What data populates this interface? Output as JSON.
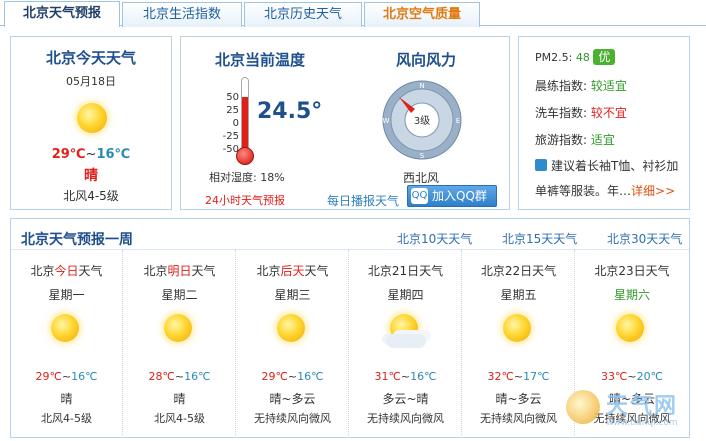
{
  "tabs": [
    {
      "label": "北京天气预报"
    },
    {
      "label": "北京生活指数"
    },
    {
      "label": "北京历史天气"
    },
    {
      "label": "北京空气质量"
    }
  ],
  "today": {
    "title": "北京今天天气",
    "date": "05月18日",
    "temp_high": "29℃",
    "temp_sep": "~",
    "temp_low": "16℃",
    "condition": "晴",
    "wind": "北风4-5级"
  },
  "current": {
    "title": "北京当前温度",
    "temperature": "24.5°",
    "temperature_value": 24.5,
    "ticks": [
      "50",
      "25",
      "0",
      "-25",
      "-50"
    ],
    "humidity": "相对湿度: 18%",
    "forecast_link": "24小时天气预报"
  },
  "wind_panel": {
    "title": "风向风力",
    "level": "3级",
    "direction": "西北风",
    "compass": {
      "n": "N",
      "s": "S",
      "e": "E",
      "w": "W"
    },
    "daily_broadcast": "每日播报天气",
    "qq_button": "加入QQ群",
    "qq_icon": "QQ"
  },
  "indices": {
    "pm_label": "PM2.5: ",
    "pm_value": "48",
    "pm_badge": "优",
    "items": [
      {
        "label": "晨练指数: ",
        "value": "较适宜",
        "color": "#2e9a26"
      },
      {
        "label": "洗车指数: ",
        "value": "较不宜",
        "color": "#e0201a"
      },
      {
        "label": "旅游指数: ",
        "value": "适宜",
        "color": "#2e9a26"
      }
    ],
    "tip_line1": "建议着长袖T恤、衬衫加",
    "tip_line2": "单裤等服装。年…",
    "tip_more": "详细>>"
  },
  "week": {
    "title": "北京天气预报一周",
    "links": [
      "北京10天天气",
      "北京15天天气",
      "北京30天天气"
    ],
    "days": [
      {
        "pre": "北京",
        "hl": "今日",
        "post": "天气",
        "weekday": "星期一",
        "weekday_green": false,
        "high": "29℃",
        "low": "16℃",
        "cond": "晴",
        "wind": "北风4-5级",
        "cloudy": false
      },
      {
        "pre": "北京",
        "hl": "明日",
        "post": "天气",
        "weekday": "星期二",
        "weekday_green": false,
        "high": "28℃",
        "low": "16℃",
        "cond": "晴",
        "wind": "北风4-5级",
        "cloudy": false
      },
      {
        "pre": "北京",
        "hl": "后天",
        "post": "天气",
        "weekday": "星期三",
        "weekday_green": false,
        "high": "29℃",
        "low": "16℃",
        "cond": "晴~多云",
        "wind": "无持续风向微风",
        "cloudy": false
      },
      {
        "pre": "北京21日天气",
        "hl": "",
        "post": "",
        "weekday": "星期四",
        "weekday_green": false,
        "high": "31℃",
        "low": "16℃",
        "cond": "多云~晴",
        "wind": "无持续风向微风",
        "cloudy": true
      },
      {
        "pre": "北京22日天气",
        "hl": "",
        "post": "",
        "weekday": "星期五",
        "weekday_green": false,
        "high": "32℃",
        "low": "17℃",
        "cond": "晴~多云",
        "wind": "无持续风向微风",
        "cloudy": false
      },
      {
        "pre": "北京23日天气",
        "hl": "",
        "post": "",
        "weekday": "星期六",
        "weekday_green": true,
        "high": "33℃",
        "low": "20℃",
        "cond": "晴~多云",
        "wind": "无持续风向微风",
        "cloudy": false
      }
    ]
  },
  "watermark": {
    "text": "天气网",
    "url": "www.tianqi.com"
  }
}
